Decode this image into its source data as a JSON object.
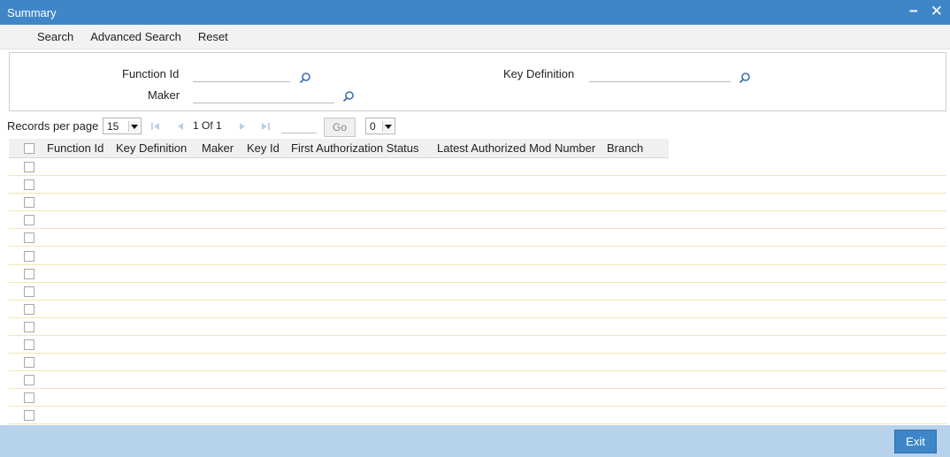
{
  "window": {
    "title": "Summary",
    "minimize_label": "−",
    "close_label": "✕"
  },
  "menu": {
    "items": [
      "Search",
      "Advanced Search",
      "Reset"
    ]
  },
  "criteria": {
    "function_id_label": "Function Id",
    "maker_label": "Maker",
    "key_definition_label": "Key Definition",
    "function_id_value": "",
    "maker_value": "",
    "key_definition_value": "",
    "lookup_icon": "search-icon"
  },
  "pager": {
    "records_label": "Records per page",
    "records_value": "15",
    "page_info": "1 Of 1",
    "go_label": "Go",
    "jump_value": "0"
  },
  "grid": {
    "columns": [
      "Function Id",
      "Key Definition",
      "Maker",
      "Key Id",
      "First Authorization Status",
      "Latest Authorized Mod Number",
      "Branch"
    ],
    "row_count": 15
  },
  "footer": {
    "exit_label": "Exit"
  },
  "colors": {
    "title_bar": "#3f86c8",
    "footer_bar": "#b7d3ec",
    "row_divider": "#f2e6b8"
  }
}
